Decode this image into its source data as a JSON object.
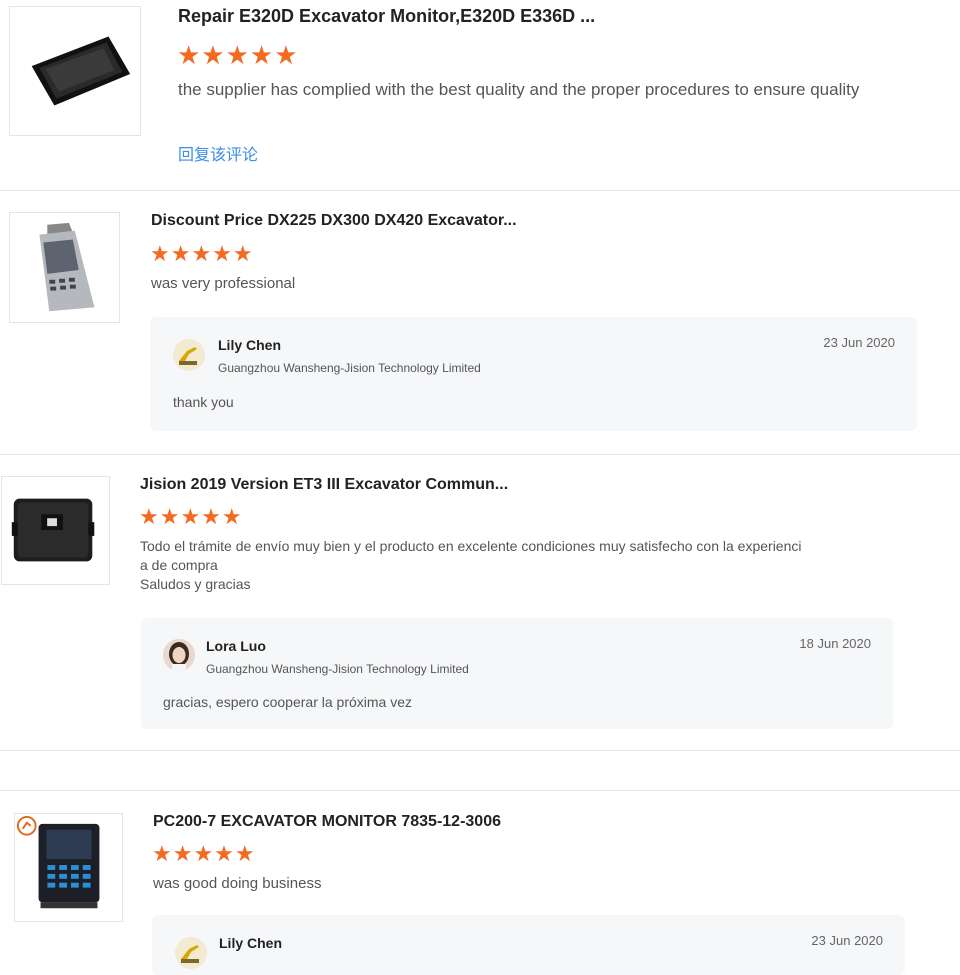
{
  "reviews": [
    {
      "product_title": "Repair E320D Excavator Monitor,E320D E336D ...",
      "stars": "★★★★★",
      "comment": "the supplier has complied with the best quality and the proper procedures to ensure quality",
      "reply_link": "回复该评论"
    },
    {
      "product_title": "Discount Price DX225 DX300 DX420 Excavator...",
      "stars": "★★★★★",
      "comment": "was very professional",
      "reply": {
        "name": "Lily Chen",
        "company": "Guangzhou Wansheng-Jision Technology Limited",
        "date": "23 Jun 2020",
        "text": "thank you"
      }
    },
    {
      "product_title": "Jision 2019 Version ET3 III Excavator Commun...",
      "stars": "★★★★★",
      "comment_line1": "Todo el trámite de envío muy bien y el producto en excelente condiciones muy satisfecho con la experienci",
      "comment_line2": "a de compra",
      "comment_line3": "Saludos y gracias",
      "reply": {
        "name": "Lora Luo",
        "company": "Guangzhou Wansheng-Jision Technology Limited",
        "date": "18 Jun 2020",
        "text": "gracias, espero cooperar la próxima vez"
      }
    },
    {
      "product_title": "PC200-7 EXCAVATOR MONITOR 7835-12-3006",
      "stars": "★★★★★",
      "comment": "was good doing business",
      "reply": {
        "name": "Lily Chen",
        "date": "23 Jun 2020"
      }
    }
  ],
  "colors": {
    "star": "#f36a22",
    "link": "#3a8ee6",
    "reply_bg": "#f6f7f9"
  }
}
